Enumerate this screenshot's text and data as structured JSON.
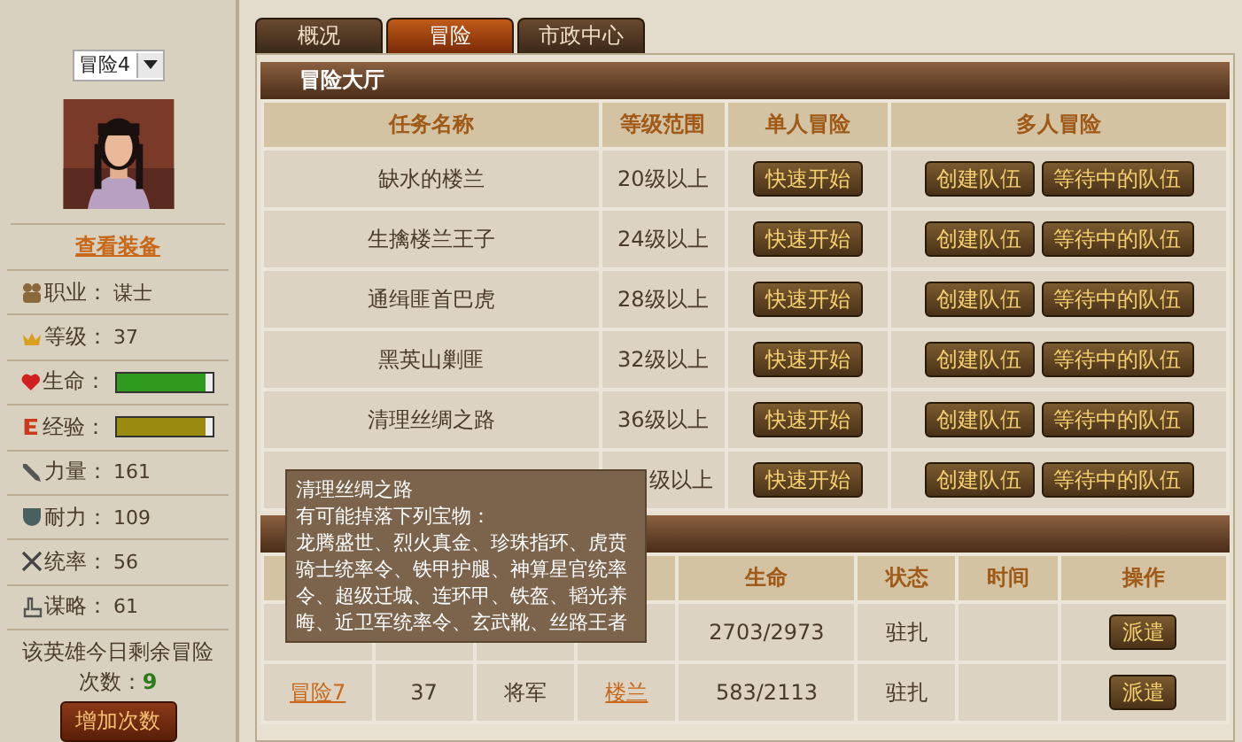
{
  "hero_select": {
    "value": "冒险4"
  },
  "view_equipment": "查看装备",
  "stats": [
    {
      "kind": "text",
      "label": "职业：",
      "value": "谋士"
    },
    {
      "kind": "text",
      "label": "等级：",
      "value": "37"
    },
    {
      "kind": "bar",
      "label": "生命：",
      "level": 0.93,
      "color": "#2f9a1e"
    },
    {
      "kind": "bar",
      "label": "经验：",
      "level": 0.93,
      "color": "#9a8a10"
    },
    {
      "kind": "text",
      "label": "力量：",
      "value": "161"
    },
    {
      "kind": "text",
      "label": "耐力：",
      "value": "109"
    },
    {
      "kind": "text",
      "label": "统率：",
      "value": "56"
    },
    {
      "kind": "text",
      "label": "谋略：",
      "value": "61"
    }
  ],
  "remaining": {
    "text": "该英雄今日剩余冒险",
    "count_label": "次数：",
    "count": "9"
  },
  "add_button": "增加次数",
  "tabs": [
    {
      "label": "概况",
      "selected": false
    },
    {
      "label": "冒险",
      "selected": true
    },
    {
      "label": "市政中心",
      "selected": false
    }
  ],
  "hall": {
    "title": "冒险大厅",
    "columns": [
      "任务名称",
      "等级范围",
      "单人冒险",
      "多人冒险"
    ],
    "rows": [
      {
        "name": "缺水的楼兰",
        "level": "20级以上",
        "solo": "快速开始",
        "create": "创建队伍",
        "waiting": "等待中的队伍"
      },
      {
        "name": "生擒楼兰王子",
        "level": "24级以上",
        "solo": "快速开始",
        "create": "创建队伍",
        "waiting": "等待中的队伍"
      },
      {
        "name": "通缉匪首巴虎",
        "level": "28级以上",
        "solo": "快速开始",
        "create": "创建队伍",
        "waiting": "等待中的队伍"
      },
      {
        "name": "黑英山剿匪",
        "level": "32级以上",
        "solo": "快速开始",
        "create": "创建队伍",
        "waiting": "等待中的队伍"
      },
      {
        "name": "清理丝绸之路",
        "level": "36级以上",
        "solo": "快速开始",
        "create": "创建队伍",
        "waiting": "等待中的队伍"
      },
      {
        "level": "级以上",
        "solo": "快速开始",
        "create": "创建队伍",
        "waiting": "等待中的队伍"
      }
    ]
  },
  "heroes": {
    "columns": [
      "生命",
      "状态",
      "时间",
      "操作"
    ],
    "rows": [
      {
        "life": "2703/2973",
        "status": "驻扎",
        "action": "派遣"
      },
      {
        "name": "冒险7",
        "level": "37",
        "rank": "将军",
        "place": "楼兰",
        "life": "583/2113",
        "status": "驻扎",
        "action": "派遣"
      }
    ]
  },
  "tooltip": {
    "title": "清理丝绸之路",
    "subtitle": "有可能掉落下列宝物：",
    "items": "龙腾盛世、烈火真金、珍珠指环、虎贲骑士统率令、铁甲护腿、神算星官统率令、超级迁城、连环甲、铁盔、韬光养晦、近卫军统率令、玄武靴、丝路王者"
  }
}
